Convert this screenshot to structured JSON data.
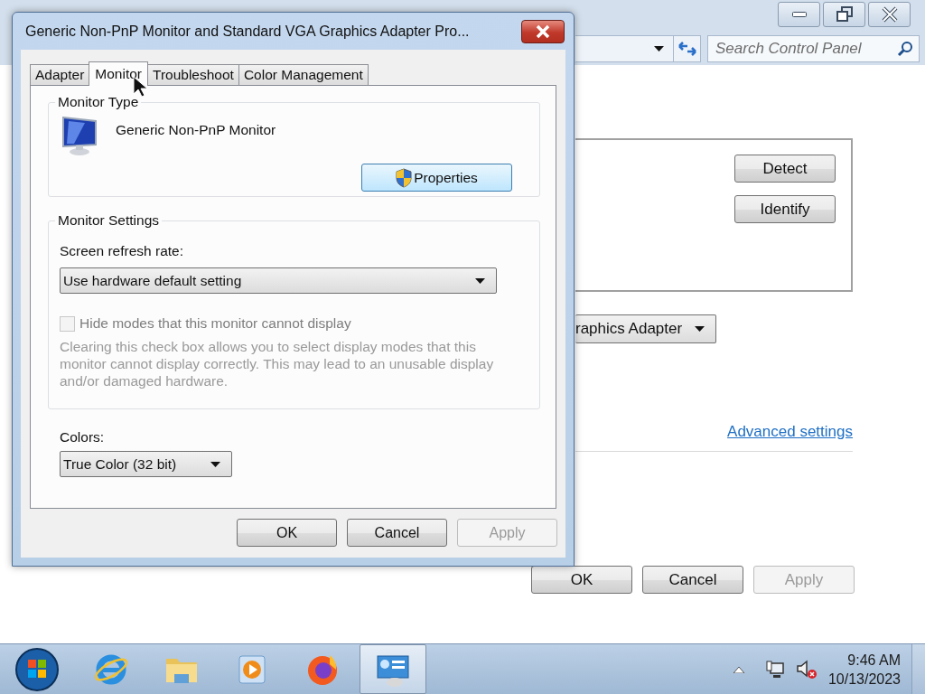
{
  "background_window": {
    "search": {
      "placeholder": "Search Control Panel"
    },
    "display_buttons": [
      "Detect",
      "Identify"
    ],
    "display_dropdown": {
      "value": "raphics Adapter"
    },
    "advanced_link": "Advanced settings",
    "buttons": [
      {
        "label": "OK",
        "disabled": false
      },
      {
        "label": "Cancel",
        "disabled": false
      },
      {
        "label": "Apply",
        "disabled": true
      }
    ]
  },
  "dialog": {
    "title": "Generic Non-PnP Monitor and Standard VGA Graphics Adapter Pro...",
    "tabs": [
      {
        "label": "Adapter",
        "selected": false
      },
      {
        "label": "Monitor",
        "selected": true
      },
      {
        "label": "Troubleshoot",
        "selected": false
      },
      {
        "label": "Color Management",
        "selected": false
      }
    ],
    "monitor_type": {
      "heading": "Monitor Type",
      "name": "Generic Non-PnP Monitor",
      "properties_button": "Properties"
    },
    "monitor_settings": {
      "heading": "Monitor Settings",
      "refresh_label": "Screen refresh rate:",
      "refresh_value": "Use hardware default setting",
      "hide_modes": {
        "label": "Hide modes that this monitor cannot display",
        "checked": false,
        "disabled": true
      },
      "explanation": "Clearing this check box allows you to select display modes that this monitor cannot display correctly. This may lead to an unusable display and/or damaged hardware."
    },
    "colors": {
      "label": "Colors:",
      "value": "True Color (32 bit)"
    },
    "buttons": [
      {
        "label": "OK",
        "disabled": false
      },
      {
        "label": "Cancel",
        "disabled": false
      },
      {
        "label": "Apply",
        "disabled": true
      }
    ]
  },
  "taskbar": {
    "apps": [
      {
        "kind": "ie",
        "selected": false
      },
      {
        "kind": "explorer",
        "selected": false
      },
      {
        "kind": "player",
        "selected": false
      },
      {
        "kind": "firefox",
        "selected": false
      },
      {
        "kind": "panel",
        "selected": true
      }
    ],
    "clock": {
      "time": "9:46 AM",
      "date": "10/13/2023"
    }
  }
}
